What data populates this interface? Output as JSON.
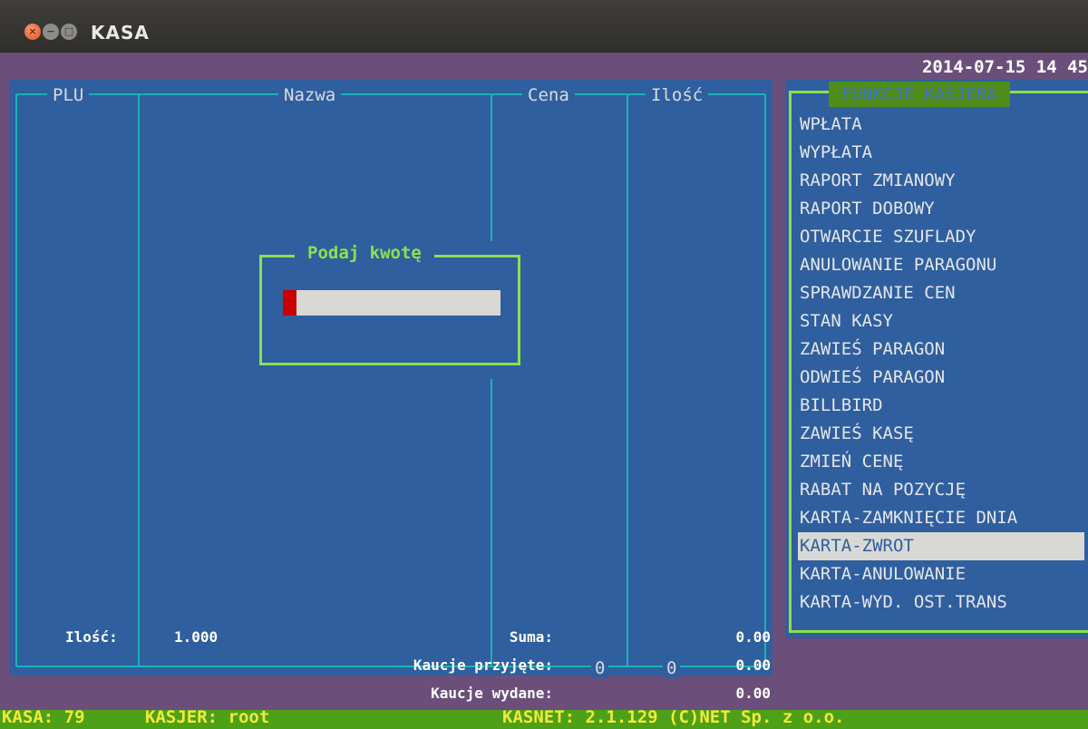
{
  "window": {
    "title": "KASA",
    "close_glyph": "×",
    "minimize_glyph": "−",
    "maximize_glyph": "□"
  },
  "header": {
    "datetime": "2014-07-15 14 45"
  },
  "table": {
    "columns": [
      "PLU",
      "Nazwa",
      "Cena",
      "Ilość"
    ],
    "cena_count": "0",
    "ilosc_count": "0"
  },
  "dialog": {
    "title": "Podaj kwotę",
    "value": ""
  },
  "functions": {
    "title": "FUNKCJE KASJERA",
    "items": [
      "WPŁATA",
      "WYPŁATA",
      "RAPORT ZMIANOWY",
      "RAPORT DOBOWY",
      "OTWARCIE SZUFLADY",
      "ANULOWANIE PARAGONU",
      "SPRAWDZANIE CEN",
      "STAN KASY",
      "ZAWIEŚ PARAGON",
      "ODWIEŚ PARAGON",
      "BILLBIRD",
      "ZAWIEŚ KASĘ",
      "ZMIEŃ CENĘ",
      "RABAT NA POZYCJĘ",
      "KARTA-ZAMKNIĘCIE DNIA",
      "KARTA-ZWROT",
      "KARTA-ANULOWANIE",
      "KARTA-WYD. OST.TRANS"
    ],
    "selected_index": 15
  },
  "totals": {
    "ilosc_label": "Ilość:",
    "ilosc_value": "1.000",
    "suma_label": "Suma:",
    "suma_value": "0.00",
    "kaucje_przyjete_label": "Kaucje przyjęte:",
    "kaucje_przyjete_value": "0.00",
    "kaucje_wydane_label": "Kaucje wydane:",
    "kaucje_wydane_value": "0.00"
  },
  "status": {
    "kasa": "KASA: 79",
    "kasjer": "KASJER: root",
    "version": "KASNET: 2.1.129 (C)NET Sp. z o.o."
  },
  "colors": {
    "terminal_bg": "#6b4f7a",
    "panel_bg": "#2f5f9e",
    "accent_green": "#8de04d",
    "status_bg": "#4fa019",
    "status_text": "#f0ea3a",
    "cursor": "#c90000",
    "selection": "#d8d8d4"
  }
}
